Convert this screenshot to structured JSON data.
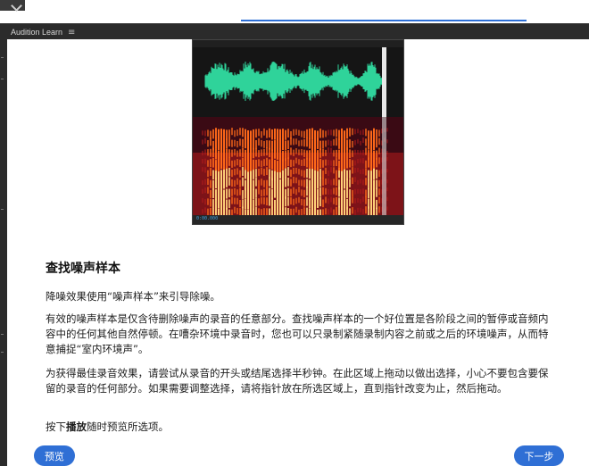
{
  "panel": {
    "title": "Audition Learn",
    "menu_icon": "hamburger-menu-icon"
  },
  "editor_screenshot": {
    "time_readout": "0:00.000",
    "waveform_color": "#2fd39a",
    "spectrogram_colors": [
      "#3a0a14",
      "#b41c1c",
      "#ff6a1a",
      "#ffd27a"
    ]
  },
  "content": {
    "heading": "查找噪声样本",
    "para1": "降噪效果使用“噪声样本”来引导除噪。",
    "para2": "有效的噪声样本是仅含待删除噪声的录音的任意部分。查找噪声样本的一个好位置是各阶段之间的暂停或音频内容中的任何其他自然停顿。在嘈杂环境中录音时，您也可以只录制紧随录制内容之前或之后的环境噪声，从而特意捕捉“室内环境声”。",
    "para3": "为获得最佳录音效果，请尝试从录音的开头或结尾选择半秒钟。在此区域上拖动以做出选择，小心不要包含要保留的录音的任何部分。如果需要调整选择，请将指针放在所选区域上，直到指针改变为止，然后拖动。",
    "para4_prefix": "按下",
    "para4_bold": "播放",
    "para4_suffix": "随时预览所选项。"
  },
  "buttons": {
    "preview": "预览",
    "next": "下一步"
  },
  "colors": {
    "accent": "#2f6fd5",
    "panel_bg": "#2b2b2b"
  }
}
